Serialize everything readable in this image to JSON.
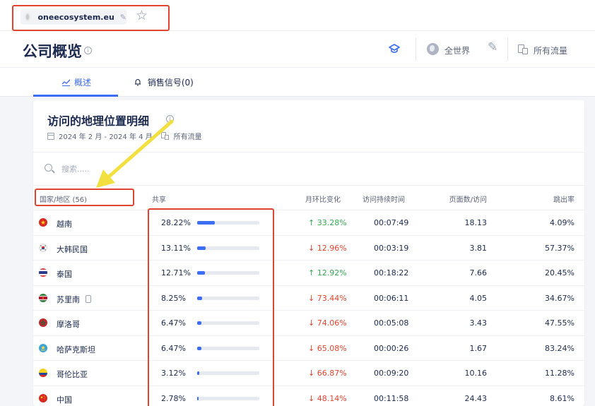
{
  "browser": {
    "url": "oneecosystem.eu"
  },
  "header": {
    "title": "公司概览",
    "region": "全世界",
    "traffic": "所有流量"
  },
  "tabs": [
    {
      "label": "概述"
    },
    {
      "label": "销售信号(0)"
    }
  ],
  "card": {
    "title": "访问的地理位置明细",
    "date_range": "2024 年 2 月 - 2024 年 4 月",
    "traffic": "所有流量",
    "search_placeholder": "搜索.....",
    "columns": {
      "country": "国家/地区 (56)",
      "share": "共享",
      "change": "月环比变化",
      "duration": "访问持续时间",
      "pages": "页面数/访问",
      "bounce": "跳出率"
    },
    "rows": [
      {
        "country": "越南",
        "share": "28.22%",
        "share_value": 28.22,
        "change": "↑ 33.28%",
        "trend": "up",
        "duration": "00:07:49",
        "pages": "18.13",
        "bounce": "4.09%",
        "flag": "vietnam-flag"
      },
      {
        "country": "大韩民国",
        "share": "13.11%",
        "share_value": 13.11,
        "change": "↓ 12.96%",
        "trend": "down",
        "duration": "00:03:19",
        "pages": "3.81",
        "bounce": "57.37%",
        "flag": "south-korea-flag"
      },
      {
        "country": "泰国",
        "share": "12.71%",
        "share_value": 12.71,
        "change": "↑ 12.92%",
        "trend": "up",
        "duration": "00:18:22",
        "pages": "7.66",
        "bounce": "20.45%",
        "flag": "thailand-flag"
      },
      {
        "country": "苏里南",
        "share": "8.25%",
        "share_value": 8.25,
        "change": "↓ 73.44%",
        "trend": "down",
        "duration": "00:06:11",
        "pages": "4.05",
        "bounce": "34.67%",
        "flag": "suriname-flag",
        "device": "mobile-icon"
      },
      {
        "country": "摩洛哥",
        "share": "6.47%",
        "share_value": 6.47,
        "change": "↓ 74.06%",
        "trend": "down",
        "duration": "00:05:08",
        "pages": "3.43",
        "bounce": "47.55%",
        "flag": "morocco-flag"
      },
      {
        "country": "哈萨克斯坦",
        "share": "6.47%",
        "share_value": 6.47,
        "change": "↓ 65.08%",
        "trend": "down",
        "duration": "00:00:26",
        "pages": "1.67",
        "bounce": "83.24%",
        "flag": "kazakhstan-flag"
      },
      {
        "country": "哥伦比亚",
        "share": "3.12%",
        "share_value": 3.12,
        "change": "↓ 66.87%",
        "trend": "down",
        "duration": "00:09:20",
        "pages": "10.16",
        "bounce": "11.28%",
        "flag": "colombia-flag"
      },
      {
        "country": "中国",
        "share": "2.78%",
        "share_value": 2.78,
        "change": "↓ 48.14%",
        "trend": "down",
        "duration": "00:11:58",
        "pages": "24.43",
        "bounce": "8.61%",
        "flag": "china-flag"
      }
    ]
  },
  "colors": {
    "accent": "#3b6ef5",
    "up": "#36a853",
    "down": "#e2452f",
    "highlight": "#e2452f",
    "arrow": "#f2e040"
  }
}
